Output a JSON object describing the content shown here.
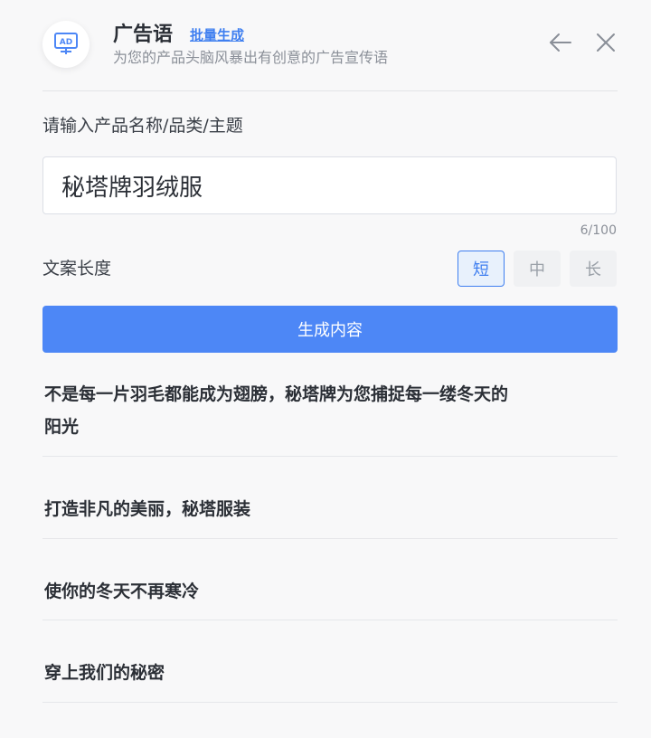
{
  "header": {
    "icon": "ad-board-icon",
    "title": "广告语",
    "batch_link": "批量生成",
    "subtitle": "为您的产品头脑风暴出有创意的广告宣传语"
  },
  "form": {
    "input_label": "请输入产品名称/品类/主题",
    "input_value": "秘塔牌羽绒服",
    "char_count": "6/100",
    "length_label": "文案长度",
    "length_options": [
      "短",
      "中",
      "长"
    ],
    "length_selected": "短",
    "generate_label": "生成内容"
  },
  "results": [
    "不是每一片羽毛都能成为翅膀，秘塔牌为您捕捉每一缕冬天的阳光",
    "打造非凡的美丽，秘塔服装",
    "使你的冬天不再寒冷",
    "穿上我们的秘密"
  ],
  "colors": {
    "accent": "#4d87f6",
    "link": "#3f7ff0",
    "background": "#f8f8f9"
  }
}
